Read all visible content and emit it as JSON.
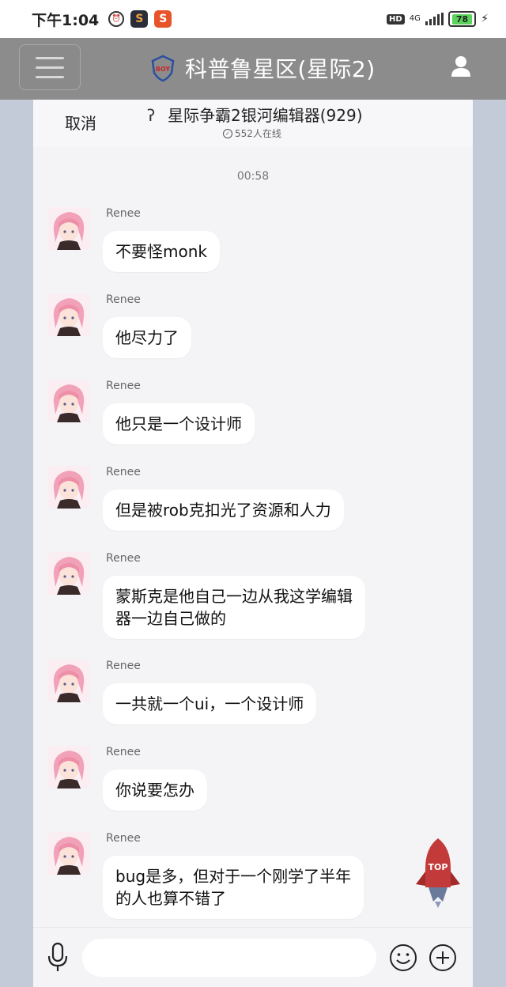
{
  "status_bar": {
    "time": "下午1:04",
    "network": "4G",
    "battery": "78",
    "hd": "HD"
  },
  "header": {
    "title": "科普鲁星区(星际2)",
    "logo_text": "BOY"
  },
  "subheader": {
    "cancel_label": "取消",
    "group_name": "星际争霸2银河编辑器(929)",
    "online_count": "552人在线"
  },
  "chat": {
    "timestamp": "00:58",
    "messages": [
      {
        "sender": "Renee",
        "text": "不要怪monk"
      },
      {
        "sender": "Renee",
        "text": "他尽力了"
      },
      {
        "sender": "Renee",
        "text": "他只是一个设计师"
      },
      {
        "sender": "Renee",
        "text": "但是被rob克扣光了资源和人力"
      },
      {
        "sender": "Renee",
        "text_line1": "蒙斯克是他自己一边从我这学编辑",
        "text_line2": "器一边自己做的"
      },
      {
        "sender": "Renee",
        "text": "一共就一个ui，一个设计师"
      },
      {
        "sender": "Renee",
        "text": "你说要怎办"
      },
      {
        "sender": "Renee",
        "text_line1": "bug是多，但对于一个刚学了半年",
        "text_line2": "的人也算不错了"
      }
    ]
  },
  "top_button": {
    "label": "TOP"
  },
  "input_bar": {
    "placeholder": ""
  },
  "colors": {
    "header_bg": "#8c8c8c",
    "panel_bg": "#f4f4f6",
    "bubble_bg": "#ffffff",
    "page_bg": "#c3cad8"
  }
}
